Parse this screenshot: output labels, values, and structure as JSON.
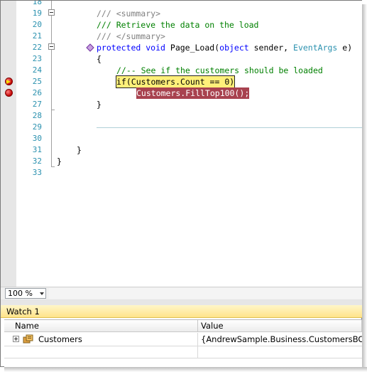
{
  "editor": {
    "lines": [
      {
        "num": "18",
        "text": ""
      },
      {
        "num": "19",
        "text": "/// <summary>"
      },
      {
        "num": "20",
        "text": "/// Retrieve the data on the load"
      },
      {
        "num": "21",
        "text": "/// </summary>"
      },
      {
        "num": "22",
        "kw1": "protected",
        "kw2": "void",
        "name": "Page_Load(",
        "kw3": "object",
        "p1": "sender,",
        "ty": "EventArgs",
        "p2": "e)"
      },
      {
        "num": "23",
        "text": "{"
      },
      {
        "num": "24",
        "text": "//-- See if the customers should be loaded"
      },
      {
        "num": "25",
        "text": "if(Customers.Count == 0)"
      },
      {
        "num": "26",
        "text": "Customers.FillTop100();"
      },
      {
        "num": "27",
        "text": "}"
      },
      {
        "num": "28",
        "text": ""
      },
      {
        "num": "29",
        "text": ""
      },
      {
        "num": "30",
        "text": ""
      },
      {
        "num": "31",
        "text": "}"
      },
      {
        "num": "32",
        "text": "}"
      },
      {
        "num": "33",
        "text": ""
      }
    ]
  },
  "zoom": {
    "value": "100 %"
  },
  "watch": {
    "title": "Watch 1",
    "columns": {
      "name": "Name",
      "value": "Value"
    },
    "rows": [
      {
        "name": "Customers",
        "value": "{AndrewSample.Business.CustomersBO}"
      }
    ]
  },
  "colors": {
    "breakpoint": "#c00000",
    "current_line": "#fff07a",
    "breakpoint_line": "#a8424f"
  }
}
